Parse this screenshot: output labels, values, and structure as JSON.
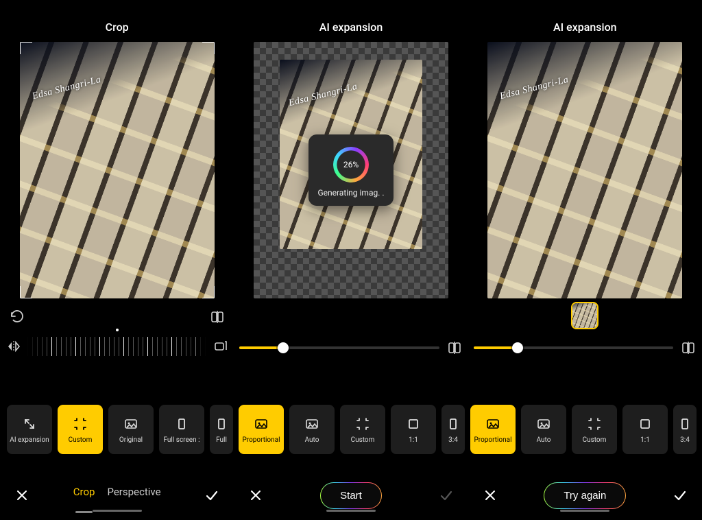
{
  "panels": {
    "crop": {
      "title": "Crop",
      "rotate_icon": "rotate-icon",
      "compare_icon": "compare-icon",
      "flip_h_icon": "flip-horizontal-icon",
      "aspect_icon": "aspect-copy-icon",
      "tabs": {
        "crop": "Crop",
        "perspective": "Perspective"
      }
    },
    "expansion_progress": {
      "title": "AI expansion",
      "progress_pct": "26%",
      "progress_status": "Generating imag. .",
      "slider_value_pct": 22,
      "compare_icon": "compare-icon",
      "action_button": "Start"
    },
    "expansion_result": {
      "title": "AI expansion",
      "slider_value_pct": 22,
      "compare_icon": "compare-icon",
      "action_button": "Try again"
    }
  },
  "building_sign": "Edsa Shangri-La",
  "presets": [
    {
      "icon": "expand-arrows-icon",
      "label": "AI expansion"
    },
    {
      "icon": "free-crop-icon",
      "label": "Custom",
      "active_in": "crop"
    },
    {
      "icon": "image-icon",
      "label": "Original"
    },
    {
      "icon": "portrait-rect-icon",
      "label": "Full screen :"
    },
    {
      "icon": "portrait-rect-icon",
      "label": "Full"
    },
    {
      "icon": "image-icon",
      "label": "Proportional",
      "active_in": "expansion"
    },
    {
      "icon": "image-icon",
      "label": "Auto"
    },
    {
      "icon": "free-crop-icon",
      "label": "Custom"
    },
    {
      "icon": "square-icon",
      "label": "1:1"
    },
    {
      "icon": "portrait-rect-icon",
      "label": "3:4"
    },
    {
      "icon": "image-icon",
      "label": "Proportional",
      "active_in": "expansion"
    },
    {
      "icon": "image-icon",
      "label": "Auto"
    },
    {
      "icon": "free-crop-icon",
      "label": "Custom"
    },
    {
      "icon": "square-icon",
      "label": "1:1"
    },
    {
      "icon": "portrait-rect-icon",
      "label": "3:4"
    }
  ],
  "close_label": "Cancel",
  "confirm_label": "Confirm"
}
